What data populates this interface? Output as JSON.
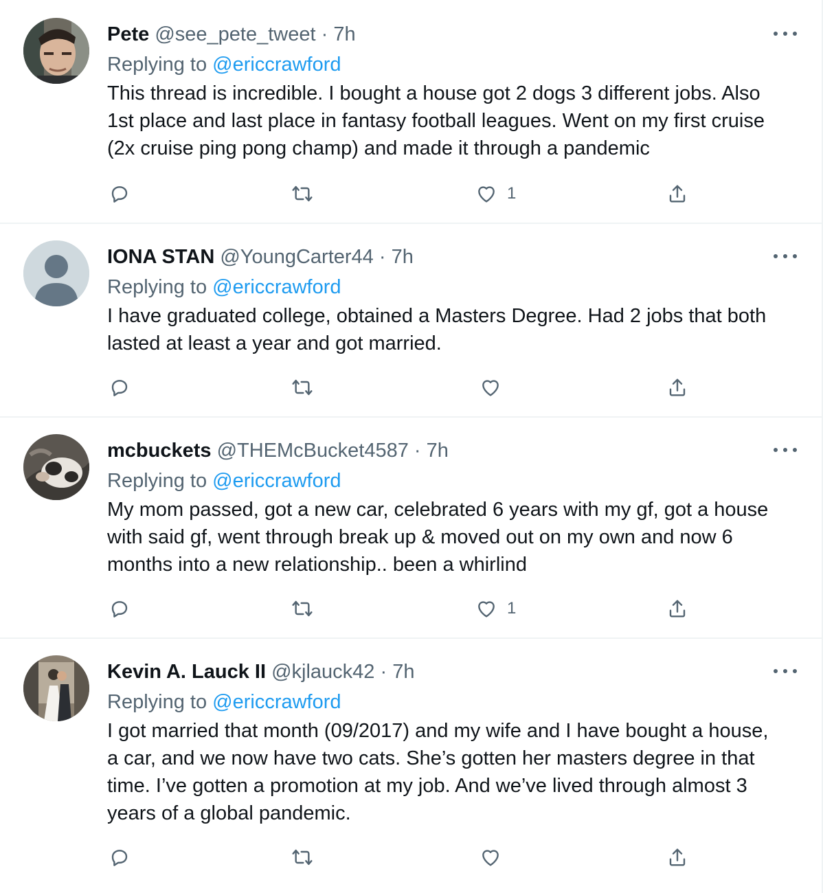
{
  "tweets": [
    {
      "name": "Pete",
      "handle": "@see_pete_tweet",
      "sep": "·",
      "time": "7h",
      "reply_prefix": "Replying to",
      "reply_to": "@ericcrawford",
      "lines": [
        "This thread is incredible. I bought a house got 2 dogs 3 different jobs. Also",
        "1st place and last place in fantasy football leagues.  Went on my first cruise",
        "(2x cruise ping pong champ) and made it through a pandemic"
      ],
      "like_count": "1"
    },
    {
      "name": "IONA STAN",
      "handle": "@YoungCarter44",
      "sep": "·",
      "time": "7h",
      "reply_prefix": "Replying to",
      "reply_to": "@ericcrawford",
      "lines": [
        "I have graduated college, obtained a Masters Degree. Had 2 jobs that both",
        "lasted at least a year and got married."
      ],
      "like_count": ""
    },
    {
      "name": "mcbuckets",
      "handle": "@THEMcBucket4587",
      "sep": "·",
      "time": "7h",
      "reply_prefix": "Replying to",
      "reply_to": "@ericcrawford",
      "lines": [
        "My mom passed, got a new car, celebrated 6 years with my gf, got a house",
        "with said gf, went through break up & moved out on my own and now 6",
        "months into a new relationship.. been a whirlind"
      ],
      "like_count": "1"
    },
    {
      "name": "Kevin A. Lauck II",
      "handle": "@kjlauck42",
      "sep": "·",
      "time": "7h",
      "reply_prefix": "Replying to",
      "reply_to": "@ericcrawford",
      "lines": [
        "I got married that month (09/2017) and my wife and I have bought a house,",
        "a car, and we now have two cats. She’s gotten her masters degree in that",
        "time. I’ve gotten a promotion at my job. And we’ve lived through almost 3",
        "years of a global pandemic."
      ],
      "like_count": ""
    }
  ],
  "icons": {
    "more": "more-icon",
    "reply": "reply-icon",
    "retweet": "retweet-icon",
    "like": "like-icon",
    "share": "share-icon"
  },
  "colors": {
    "text": "#0f1419",
    "secondary": "#536471",
    "link": "#1d9bf0",
    "divider": "#eff3f4"
  }
}
